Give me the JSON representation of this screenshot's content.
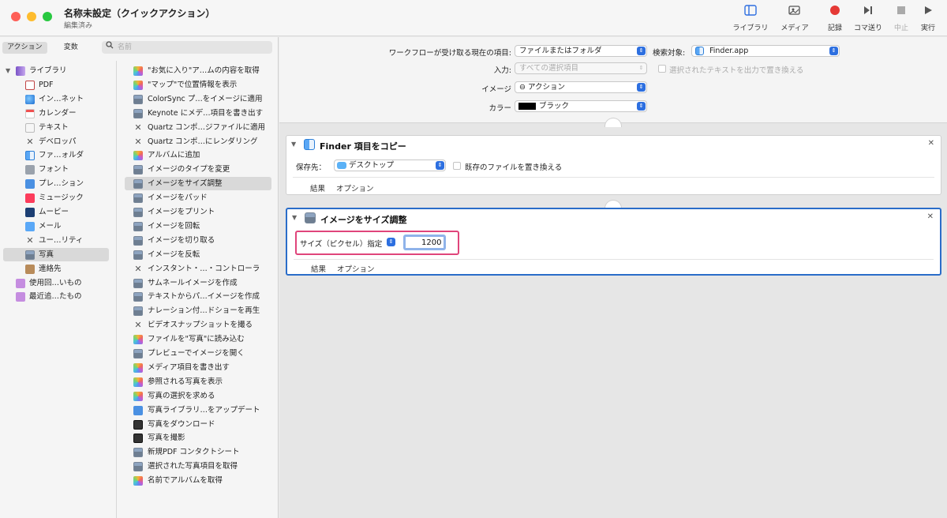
{
  "window": {
    "title": "名称未設定（クイックアクション）",
    "subtitle": "編集済み"
  },
  "toolbar": {
    "library": "ライブラリ",
    "media": "メディア",
    "record": "記録",
    "step": "コマ送り",
    "stop": "中止",
    "run": "実行",
    "record_color": "#e53935"
  },
  "left": {
    "tab_actions": "アクション",
    "tab_variables": "変数",
    "search_placeholder": "名前",
    "library": [
      {
        "label": "ライブラリ",
        "icon": "library-icon",
        "selected": false
      },
      {
        "label": "PDF",
        "icon": "pdf-icon",
        "selected": false
      },
      {
        "label": "イン…ネット",
        "icon": "internet-icon",
        "selected": false
      },
      {
        "label": "カレンダー",
        "icon": "calendar-icon",
        "selected": false
      },
      {
        "label": "テキスト",
        "icon": "text-icon",
        "selected": false
      },
      {
        "label": "デベロッパ",
        "icon": "developer-icon",
        "selected": false
      },
      {
        "label": "ファ…ォルダ",
        "icon": "finder-icon",
        "selected": false
      },
      {
        "label": "フォント",
        "icon": "font-icon",
        "selected": false
      },
      {
        "label": "プレ…ション",
        "icon": "presentation-icon",
        "selected": false
      },
      {
        "label": "ミュージック",
        "icon": "music-icon",
        "selected": false
      },
      {
        "label": "ムービー",
        "icon": "movie-icon",
        "selected": false
      },
      {
        "label": "メール",
        "icon": "mail-icon",
        "selected": false
      },
      {
        "label": "ユー…リティ",
        "icon": "utility-icon",
        "selected": false
      },
      {
        "label": "写真",
        "icon": "photos-icon",
        "selected": true
      },
      {
        "label": "連絡先",
        "icon": "contacts-icon",
        "selected": false
      },
      {
        "label": "使用回…いもの",
        "icon": "smart-folder-icon",
        "selected": false
      },
      {
        "label": "最近追…たもの",
        "icon": "smart-folder-icon",
        "selected": false
      }
    ],
    "actions": [
      {
        "label": "\"お気に入り\"ア…ムの内容を取得",
        "icon": "photos-icon"
      },
      {
        "label": "\"マップ\"で位置情報を表示",
        "icon": "photos-icon"
      },
      {
        "label": "ColorSync プ…をイメージに適用",
        "icon": "image-icon"
      },
      {
        "label": "Keynote にメデ…項目を書き出す",
        "icon": "image-icon"
      },
      {
        "label": "Quartz コンポ…ジファイルに適用",
        "icon": "tools-icon"
      },
      {
        "label": "Quartz コンポ…にレンダリング",
        "icon": "tools-icon"
      },
      {
        "label": "アルバムに追加",
        "icon": "photos-icon"
      },
      {
        "label": "イメージのタイプを変更",
        "icon": "image-icon"
      },
      {
        "label": "イメージをサイズ調整",
        "icon": "image-icon",
        "selected": true
      },
      {
        "label": "イメージをパッド",
        "icon": "image-icon"
      },
      {
        "label": "イメージをプリント",
        "icon": "image-icon"
      },
      {
        "label": "イメージを回転",
        "icon": "image-icon"
      },
      {
        "label": "イメージを切り取る",
        "icon": "image-icon"
      },
      {
        "label": "イメージを反転",
        "icon": "image-icon"
      },
      {
        "label": "インスタント・…・コントローラ",
        "icon": "tools-icon"
      },
      {
        "label": "サムネールイメージを作成",
        "icon": "image-icon"
      },
      {
        "label": "テキストからパ…イメージを作成",
        "icon": "image-icon"
      },
      {
        "label": "ナレーション付…ドショーを再生",
        "icon": "image-icon"
      },
      {
        "label": "ビデオスナップショットを撮る",
        "icon": "tools-icon"
      },
      {
        "label": "ファイルを\"写真\"に読み込む",
        "icon": "photos-icon"
      },
      {
        "label": "プレビューでイメージを開く",
        "icon": "image-icon"
      },
      {
        "label": "メディア項目を書き出す",
        "icon": "photos-icon"
      },
      {
        "label": "参照される写真を表示",
        "icon": "photos-icon"
      },
      {
        "label": "写真の選択を求める",
        "icon": "photos-icon"
      },
      {
        "label": "写真ライブラリ…をアップデート",
        "icon": "blue-icon"
      },
      {
        "label": "写真をダウンロード",
        "icon": "camera-icon"
      },
      {
        "label": "写真を撮影",
        "icon": "camera-icon"
      },
      {
        "label": "新規PDF コンタクトシート",
        "icon": "image-icon"
      },
      {
        "label": "選択された写真項目を取得",
        "icon": "image-icon"
      },
      {
        "label": "名前でアルバムを取得",
        "icon": "photos-icon"
      }
    ]
  },
  "workflow": {
    "receives_label": "ワークフローが受け取る現在の項目:",
    "receives_value": "ファイルまたはフォルダ",
    "search_target_label": "検索対象:",
    "search_target_value": "Finder.app",
    "input_label": "入力:",
    "input_value": "すべての選択項目",
    "output_replace_label": "選択されたテキストを出力で置き換える",
    "image_label": "イメージ",
    "image_value": "⊖ アクション",
    "color_label": "カラー",
    "color_value": "ブラック",
    "color_swatch": "#000000"
  },
  "card1": {
    "title": "Finder 項目をコピー",
    "dest_label": "保存先：",
    "dest_value": "デスクトップ",
    "replace_label": "既存のファイルを置き換える",
    "results": "結果",
    "options": "オプション"
  },
  "card2": {
    "title": "イメージをサイズ調整",
    "size_mode": "サイズ（ピクセル）指定",
    "size_value": "1200",
    "results": "結果",
    "options": "オプション",
    "highlight_color": "#e0457b"
  }
}
